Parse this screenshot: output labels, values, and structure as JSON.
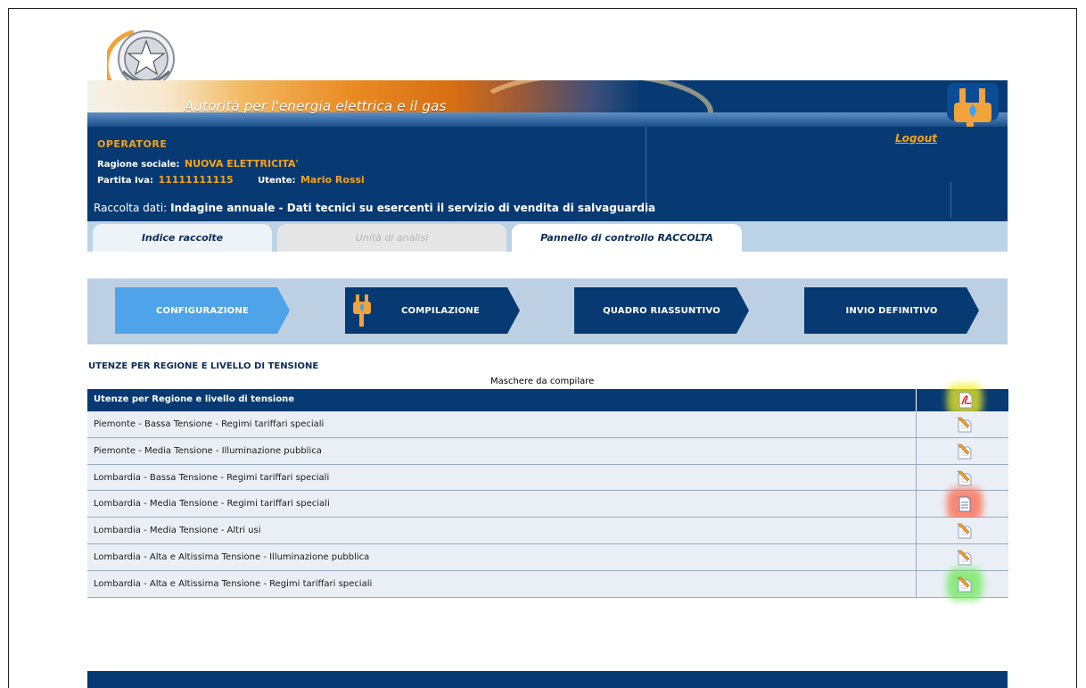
{
  "site": {
    "title": "Autorità per l'energia elettrica e il gas"
  },
  "header": {
    "operator_label": "OPERATORE",
    "ragione_label": "Ragione sociale:",
    "ragione_value": "NUOVA ELETTRICITA'",
    "piva_label": "Partita Iva:",
    "piva_value": "11111111115",
    "utente_label": "Utente:",
    "utente_value": "Mario Rossi",
    "logout": "Logout",
    "raccolta_label": "Raccolta dati:",
    "raccolta_value": "Indagine annuale - Dati tecnici su esercenti il servizio di vendita di salvaguardia"
  },
  "tabs": [
    {
      "label": "Indice raccolte",
      "state": "normal"
    },
    {
      "label": "Unità di analisi",
      "state": "disabled"
    },
    {
      "label": "Pannello di controllo RACCOLTA",
      "state": "active"
    }
  ],
  "steps": [
    {
      "label": "CONFIGURAZIONE",
      "color": "#4fa3e8"
    },
    {
      "label": "COMPILAZIONE",
      "color": "#073a72"
    },
    {
      "label": "QUADRO RIASSUNTIVO",
      "color": "#073a72"
    },
    {
      "label": "INVIO DEFINITIVO",
      "color": "#073a72"
    }
  ],
  "section": {
    "title": "UTENZE PER REGIONE E LIVELLO DI TENSIONE",
    "subtitle": "Maschere da compilare"
  },
  "table": {
    "header": "Utenze per Regione e livello di tensione",
    "header_icon": "pdf-icon",
    "rows": [
      {
        "label": "Piemonte - Bassa Tensione - Regimi tariffari speciali",
        "icon": "edit-icon",
        "highlight": ""
      },
      {
        "label": "Piemonte - Media Tensione - Illuminazione pubblica",
        "icon": "edit-icon",
        "highlight": ""
      },
      {
        "label": "Lombardia - Bassa Tensione - Regimi tariffari speciali",
        "icon": "edit-icon",
        "highlight": ""
      },
      {
        "label": "Lombardia - Media Tensione - Regimi tariffari speciali",
        "icon": "view-document-icon",
        "highlight": "#ff5a3c"
      },
      {
        "label": "Lombardia - Media Tensione - Altri usi",
        "icon": "edit-icon",
        "highlight": ""
      },
      {
        "label": "Lombardia - Alta e Altissima Tensione - Illuminazione pubblica",
        "icon": "edit-icon",
        "highlight": ""
      },
      {
        "label": "Lombardia - Alta e Altissima Tensione - Regimi tariffari speciali",
        "icon": "edit-icon",
        "highlight": "#63e84a"
      }
    ],
    "header_highlight": "#f4f21e"
  }
}
